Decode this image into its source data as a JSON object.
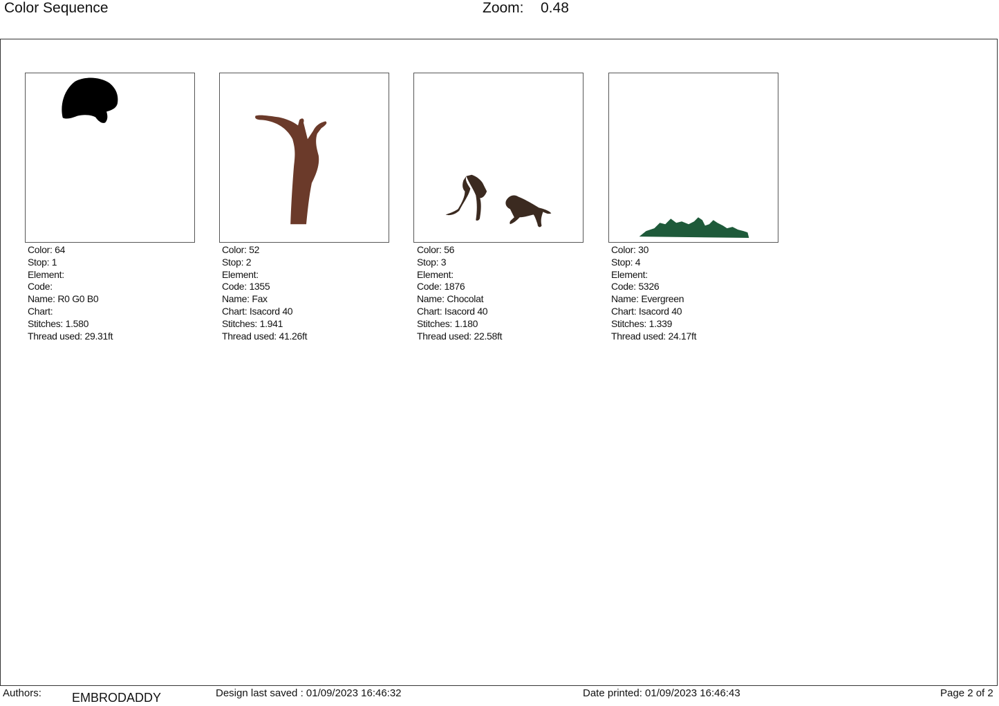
{
  "header": {
    "title": "Color Sequence",
    "zoom_label": "Zoom:",
    "zoom_value": "0.48"
  },
  "colors": [
    {
      "color_label": "Color: 64",
      "stop_label": "Stop: 1",
      "element_label": "Element:",
      "code_label": "Code:",
      "name_label": "Name: R0 G0 B0",
      "chart_label": "Chart:",
      "stitches_label": "Stitches: 1.580",
      "thread_label": "Thread used: 29.31ft",
      "swatch": "#000000",
      "preview_icon": "bear-silhouette-icon"
    },
    {
      "color_label": "Color: 52",
      "stop_label": "Stop: 2",
      "element_label": "Element:",
      "code_label": "Code: 1355",
      "name_label": "Name: Fax",
      "chart_label": "Chart: Isacord 40",
      "stitches_label": "Stitches: 1.941",
      "thread_label": "Thread used: 41.26ft",
      "swatch": "#6b3a2a",
      "preview_icon": "tree-trunk-icon"
    },
    {
      "color_label": "Color: 56",
      "stop_label": "Stop: 3",
      "element_label": "Element:",
      "code_label": "Code: 1876",
      "name_label": "Name: Chocolat",
      "chart_label": "Chart: Isacord 40",
      "stitches_label": "Stitches: 1.180",
      "thread_label": "Thread used: 22.58ft",
      "swatch": "#3b2a20",
      "preview_icon": "dogs-silhouette-icon"
    },
    {
      "color_label": "Color: 30",
      "stop_label": "Stop: 4",
      "element_label": "Element:",
      "code_label": "Code: 5326",
      "name_label": "Name: Evergreen",
      "chart_label": "Chart: Isacord 40",
      "stitches_label": "Stitches: 1.339",
      "thread_label": "Thread used: 24.17ft",
      "swatch": "#1e5a3a",
      "preview_icon": "grass-strip-icon"
    }
  ],
  "footer": {
    "authors_label": "Authors:",
    "author": "EMBRODADDY",
    "saved": "Design last saved : 01/09/2023 16:46:32",
    "printed": "Date printed: 01/09/2023 16:46:43",
    "page": "Page 2 of 2"
  }
}
